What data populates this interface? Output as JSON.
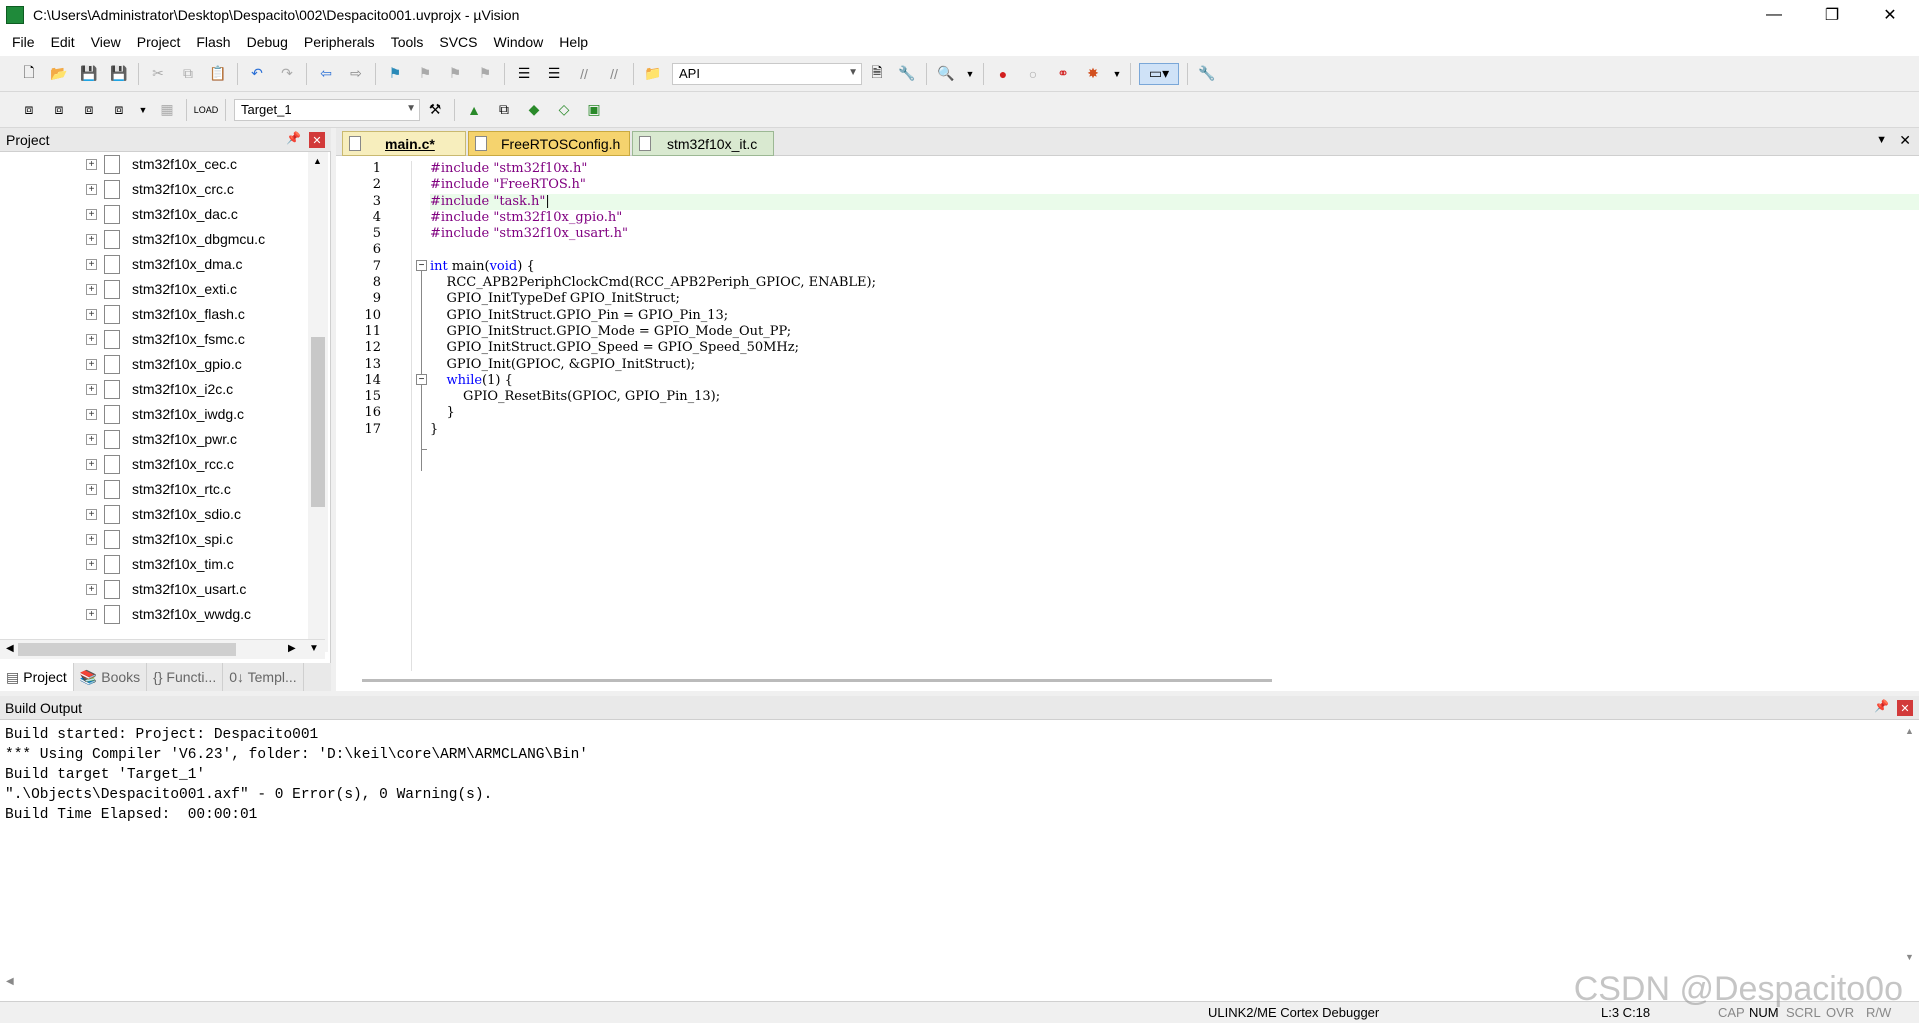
{
  "window": {
    "title": "C:\\Users\\Administrator\\Desktop\\Despacito\\002\\Despacito001.uvprojx - µVision",
    "min": "—",
    "max": "❐",
    "close": "✕"
  },
  "menu": [
    "File",
    "Edit",
    "View",
    "Project",
    "Flash",
    "Debug",
    "Peripherals",
    "Tools",
    "SVCS",
    "Window",
    "Help"
  ],
  "toolbar": {
    "api_label": "API",
    "target": "Target_1"
  },
  "project_panel": {
    "title": "Project",
    "pin": "⊓",
    "close": "✕",
    "files": [
      "stm32f10x_cec.c",
      "stm32f10x_crc.c",
      "stm32f10x_dac.c",
      "stm32f10x_dbgmcu.c",
      "stm32f10x_dma.c",
      "stm32f10x_exti.c",
      "stm32f10x_flash.c",
      "stm32f10x_fsmc.c",
      "stm32f10x_gpio.c",
      "stm32f10x_i2c.c",
      "stm32f10x_iwdg.c",
      "stm32f10x_pwr.c",
      "stm32f10x_rcc.c",
      "stm32f10x_rtc.c",
      "stm32f10x_sdio.c",
      "stm32f10x_spi.c",
      "stm32f10x_tim.c",
      "stm32f10x_usart.c",
      "stm32f10x_wwdg.c"
    ],
    "tabs": [
      "Project",
      "Books",
      "{} Functi...",
      "0↓ Templ..."
    ]
  },
  "editor": {
    "tabs": [
      {
        "label": "main.c*",
        "color": "#f5e9a6"
      },
      {
        "label": "FreeRTOSConfig.h",
        "color": "#f5d36e"
      },
      {
        "label": "stm32f10x_it.c",
        "color": "#d9e9d0"
      }
    ],
    "line_numbers": [
      "1",
      "2",
      "3",
      "4",
      "5",
      "6",
      "7",
      "8",
      "9",
      "10",
      "11",
      "12",
      "13",
      "14",
      "15",
      "16",
      "17"
    ]
  },
  "build_output": {
    "title": "Build Output",
    "lines": [
      "Build started: Project: Despacito001",
      "*** Using Compiler 'V6.23', folder: 'D:\\keil\\core\\ARM\\ARMCLANG\\Bin'",
      "Build target 'Target_1'",
      "\".\\Objects\\Despacito001.axf\" - 0 Error(s), 0 Warning(s).",
      "Build Time Elapsed:  00:00:01"
    ]
  },
  "status": {
    "debugger": "ULINK2/ME Cortex Debugger",
    "position": "L:3 C:18",
    "caps": "CAP",
    "num": "NUM",
    "scrl": "SCRL",
    "ovr": "OVR",
    "rw": "R/W"
  },
  "watermark": "CSDN @Despacito0o"
}
